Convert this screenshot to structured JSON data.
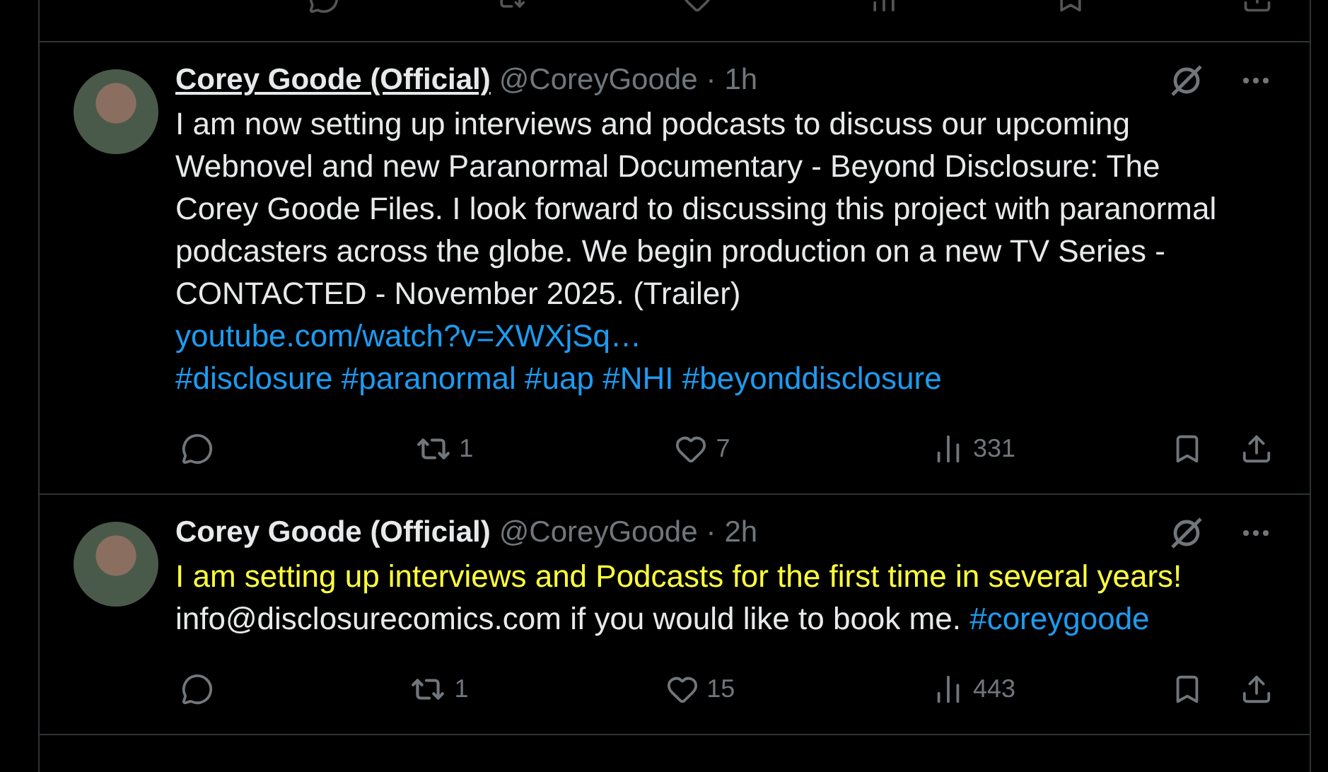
{
  "tweets": [
    {
      "author": "Corey Goode (Official)",
      "name_underlined": true,
      "handle": "@CoreyGoode",
      "separator": "·",
      "time": "1h",
      "lines": [
        [
          {
            "kind": "text",
            "text": "I am now setting up interviews and podcasts to discuss our upcoming"
          }
        ],
        [
          {
            "kind": "text",
            "text": "Webnovel and new Paranormal Documentary - Beyond Disclosure: The"
          }
        ],
        [
          {
            "kind": "text",
            "text": "Corey Goode Files. I look forward to discussing this project with paranormal"
          }
        ],
        [
          {
            "kind": "text",
            "text": "podcasters across the globe. We begin production on a new TV Series -"
          }
        ],
        [
          {
            "kind": "text",
            "text": "CONTACTED - November 2025. (Trailer)"
          }
        ],
        [
          {
            "kind": "link",
            "text": "youtube.com/watch?v=XWXjSq…"
          }
        ],
        [
          {
            "kind": "link",
            "text": "#disclosure"
          },
          {
            "kind": "link",
            "text": "#paranormal"
          },
          {
            "kind": "link",
            "text": "#uap"
          },
          {
            "kind": "link",
            "text": "#NHI"
          },
          {
            "kind": "link",
            "text": "#beyonddisclosure"
          }
        ]
      ],
      "stats": {
        "reposts": "1",
        "likes": "7",
        "views": "331"
      }
    },
    {
      "author": "Corey Goode (Official)",
      "name_underlined": false,
      "handle": "@CoreyGoode",
      "separator": "·",
      "time": "2h",
      "lines": [
        [
          {
            "kind": "highlight",
            "text": "I am setting up interviews and Podcasts for the first time in several years!"
          }
        ],
        [
          {
            "kind": "text",
            "text": "info@disclosurecomics.com if you would like to book me."
          },
          {
            "kind": "link",
            "text": "#coreygoode"
          }
        ]
      ],
      "stats": {
        "reposts": "1",
        "likes": "15",
        "views": "443"
      }
    }
  ]
}
